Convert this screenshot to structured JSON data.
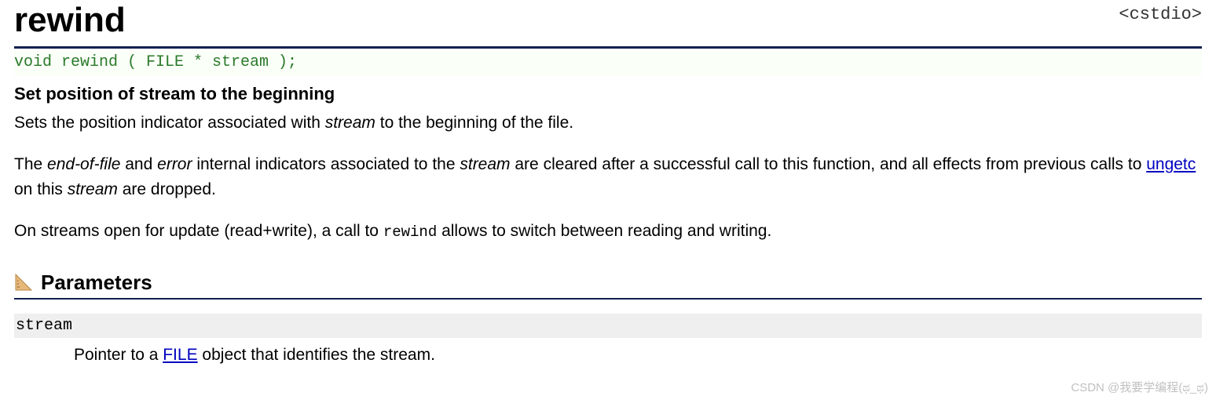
{
  "header": {
    "title": "rewind",
    "header_tag": "<cstdio>"
  },
  "signature": "void rewind ( FILE * stream );",
  "subtitle": "Set position of stream to the beginning",
  "body": {
    "p1_a": "Sets the position indicator associated with ",
    "p1_stream": "stream",
    "p1_b": " to the beginning of the file.",
    "p2_a": "The ",
    "p2_eof": "end-of-file",
    "p2_b": " and ",
    "p2_err": "error",
    "p2_c": " internal indicators associated to the ",
    "p2_stream": "stream",
    "p2_d": " are cleared after a successful call to this function, and all effects from previous calls to ",
    "p2_ungetc": "ungetc",
    "p2_e": " on this ",
    "p2_stream2": "stream",
    "p2_f": " are dropped.",
    "p3_a": "On streams open for update (read+write), a call to ",
    "p3_code": "rewind",
    "p3_b": " allows to switch between reading and writing."
  },
  "parameters": {
    "heading": "Parameters",
    "items": [
      {
        "name": "stream",
        "desc_a": "Pointer to a ",
        "desc_link": "FILE",
        "desc_b": " object that identifies the stream."
      }
    ]
  },
  "watermark": "CSDN @我要学编程(ಥ_ಥ)"
}
